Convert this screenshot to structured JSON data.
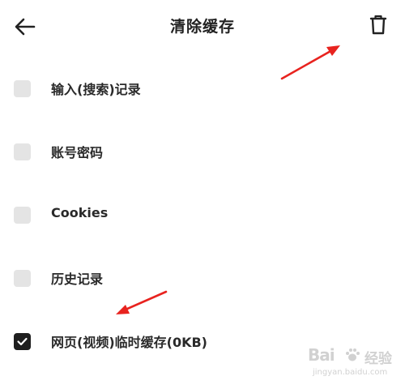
{
  "header": {
    "back_icon": "arrow-left-icon",
    "title": "清除缓存",
    "trash_icon": "trash-icon"
  },
  "options": [
    {
      "label": "输入(搜索)记录",
      "checked": false
    },
    {
      "label": "账号密码",
      "checked": false
    },
    {
      "label": "Cookies",
      "checked": false
    },
    {
      "label": "历史记录",
      "checked": false
    },
    {
      "label": "网页(视频)临时缓存(0KB)",
      "checked": true
    }
  ],
  "annotations": {
    "arrow_color": "#e8231f"
  },
  "watermark": {
    "brand": "Bai",
    "site": "经验",
    "url": "jingyan.baidu.com"
  },
  "colors": {
    "checkbox_unchecked": "#e4e4e4",
    "checkbox_checked": "#1f1f1f",
    "text": "#2a2a2a"
  }
}
